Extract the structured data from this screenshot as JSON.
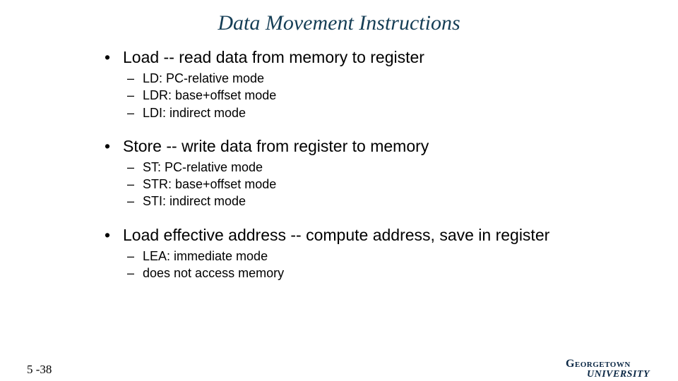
{
  "title": "Data Movement Instructions",
  "bullets": [
    {
      "text": "Load -- read data from memory to register",
      "subs": [
        "LD: PC-relative mode",
        "LDR: base+offset mode",
        "LDI: indirect mode"
      ]
    },
    {
      "text": "Store -- write data from register to memory",
      "subs": [
        "ST: PC-relative mode",
        "STR: base+offset mode",
        "STI: indirect mode"
      ]
    },
    {
      "text": "Load effective address -- compute address, save in register",
      "subs": [
        "LEA: immediate mode",
        "does not access memory"
      ]
    }
  ],
  "page_number": "5 -38",
  "footer": {
    "top": "Georgetown",
    "bottom": "UNIVERSITY"
  }
}
